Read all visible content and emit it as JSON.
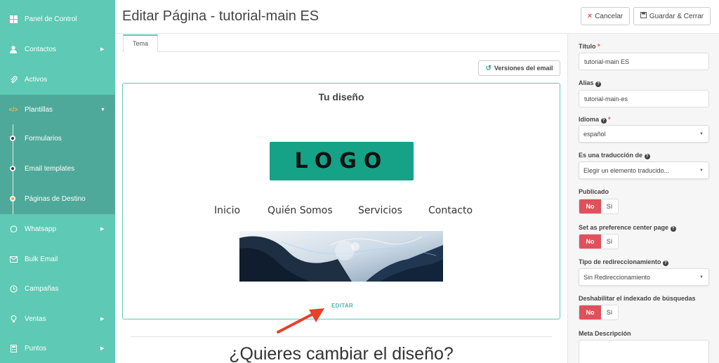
{
  "sidebar": {
    "items": [
      {
        "label": "Panel de Control",
        "icon": "dashboard-icon",
        "caret": ""
      },
      {
        "label": "Contactos",
        "icon": "user-icon",
        "caret": "▶"
      },
      {
        "label": "Activos",
        "icon": "paperclip-icon",
        "caret": ""
      },
      {
        "label": "Plantillas",
        "icon": "code-icon",
        "caret": "▼"
      },
      {
        "label": "Whatsapp",
        "icon": "whatsapp-icon",
        "caret": "▶"
      },
      {
        "label": "Bulk Email",
        "icon": "envelope-icon",
        "caret": ""
      },
      {
        "label": "Campañas",
        "icon": "clock-icon",
        "caret": ""
      },
      {
        "label": "Ventas",
        "icon": "lightbulb-icon",
        "caret": "▶"
      },
      {
        "label": "Puntos",
        "icon": "calculator-icon",
        "caret": "▶"
      }
    ],
    "subitems": [
      {
        "label": "Formularios"
      },
      {
        "label": "Email templates"
      },
      {
        "label": "Páginas de Destino"
      }
    ]
  },
  "header": {
    "title": "Editar Página - tutorial-main ES",
    "cancel_label": "Cancelar",
    "cancel_icon": "×",
    "save_label": "Guardar & Cerrar",
    "save_icon": "💾"
  },
  "main": {
    "tab_label": "Tema",
    "versions_label": "Versiones del email",
    "versions_icon": "↺",
    "design_title": "Tu diseño",
    "logo_text": "LOGO",
    "menu": [
      "Inicio",
      "Quién Somos",
      "Servicios",
      "Contacto"
    ],
    "edit_label": "EDITAR",
    "change_question": "¿Quieres cambiar el diseño?"
  },
  "form": {
    "title_label": "Título",
    "title_value": "tutorial-main ES",
    "alias_label": "Alias",
    "alias_value": "tutorial-main-es",
    "language_label": "Idioma",
    "language_value": "español",
    "translation_label": "Es una traducción de",
    "translation_value": "Elegir un elemento traducido...",
    "published_label": "Publicado",
    "preference_label": "Set as preference center page",
    "redirect_label": "Tipo de redireccionamiento",
    "redirect_value": "Sin Redireccionamiento",
    "noindex_label": "Deshabilitar el indexado de búsquedas",
    "meta_label": "Meta Descripción",
    "no_label": "No",
    "yes_label": "Sí",
    "required_mark": "*",
    "help_mark": "?"
  },
  "colors": {
    "sidebar": "#5ec9b4",
    "sidebar_active": "#4fa99a",
    "toggle_no": "#e0515b",
    "logo_bg": "#15a287",
    "accent": "#2a9d8f",
    "arrow": "#e8402a"
  }
}
